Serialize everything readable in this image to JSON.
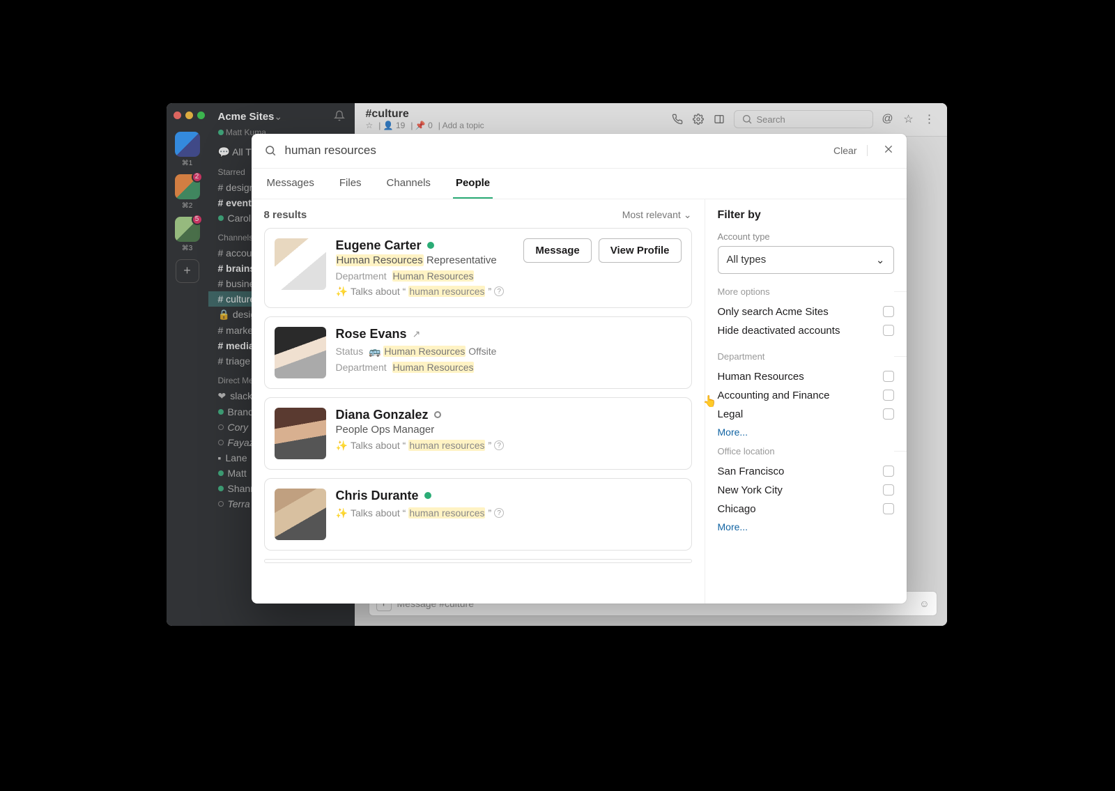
{
  "rail": {
    "workspaces": [
      {
        "shortcut": "⌘1",
        "badge": null
      },
      {
        "shortcut": "⌘2",
        "badge": "2"
      },
      {
        "shortcut": "⌘3",
        "badge": "5"
      }
    ]
  },
  "sidebar": {
    "workspace_name": "Acme Sites",
    "user_status": "Matt Kuma",
    "all_threads": "All Threads",
    "starred_label": "Starred",
    "starred": [
      {
        "text": "# design",
        "bold": false
      },
      {
        "text": "# events",
        "bold": true
      },
      {
        "text": "Carol",
        "bold": false,
        "dm": true
      }
    ],
    "channels_label": "Channels",
    "channels": [
      {
        "text": "# accounting",
        "bold": false
      },
      {
        "text": "# brainstorm",
        "bold": true
      },
      {
        "text": "# business",
        "bold": false
      },
      {
        "text": "# culture",
        "bold": false,
        "active": true
      },
      {
        "text": "🔒 design-crit",
        "bold": false
      },
      {
        "text": "# marketing",
        "bold": false
      },
      {
        "text": "# media",
        "bold": true
      },
      {
        "text": "# triage",
        "bold": false
      }
    ],
    "dms_label": "Direct Messages",
    "dms": [
      {
        "name": "slackbot",
        "online": true,
        "heart": true
      },
      {
        "name": "Brandon",
        "online": true
      },
      {
        "name": "Cory",
        "online": false,
        "italic": true
      },
      {
        "name": "Fayaz",
        "online": false,
        "italic": true
      },
      {
        "name": "Lane",
        "online": true,
        "square": true
      },
      {
        "name": "Matt",
        "online": true
      },
      {
        "name": "Shannon",
        "online": true
      },
      {
        "name": "Terra",
        "online": false,
        "italic": true
      }
    ]
  },
  "main_header": {
    "channel": "#culture",
    "members": "19",
    "pins": "0",
    "add_topic": "Add a topic",
    "search_placeholder": "Search"
  },
  "message_box": {
    "placeholder": "Message #culture"
  },
  "search_modal": {
    "query": "human resources",
    "clear": "Clear",
    "tabs": [
      "Messages",
      "Files",
      "Channels",
      "People"
    ],
    "active_tab": "People",
    "results_count": "8 results",
    "sort": "Most relevant",
    "actions": {
      "message": "Message",
      "view_profile": "View Profile"
    },
    "talks_prefix": "Talks about “",
    "talks_hl": "human resources",
    "talks_suffix": "”",
    "results": [
      {
        "name": "Eugene Carter",
        "presence": "online",
        "subtitle_pre": "",
        "subtitle_hl": "Human Resources",
        "subtitle_post": " Representative",
        "dept_label": "Department",
        "dept_hl": "Human Resources",
        "show_talks": true,
        "show_actions": true
      },
      {
        "name": "Rose Evans",
        "presence": "link",
        "status_label": "Status",
        "status_emoji": "🚌",
        "status_hl": "Human Resources",
        "status_post": " Offsite",
        "dept_label": "Department",
        "dept_hl": "Human Resources",
        "show_talks": false
      },
      {
        "name": "Diana Gonzalez",
        "presence": "away",
        "subtitle_plain": "People Ops Manager",
        "show_talks": true
      },
      {
        "name": "Chris Durante",
        "presence": "online",
        "show_talks": true
      }
    ],
    "filters": {
      "title": "Filter by",
      "account_type_label": "Account type",
      "account_type_value": "All types",
      "more_options_label": "More options",
      "more_options": [
        "Only search Acme Sites",
        "Hide deactivated accounts"
      ],
      "department_label": "Department",
      "departments": [
        "Human Resources",
        "Accounting and Finance",
        "Legal"
      ],
      "office_label": "Office location",
      "offices": [
        "San Francisco",
        "New York City",
        "Chicago"
      ],
      "more": "More..."
    }
  }
}
